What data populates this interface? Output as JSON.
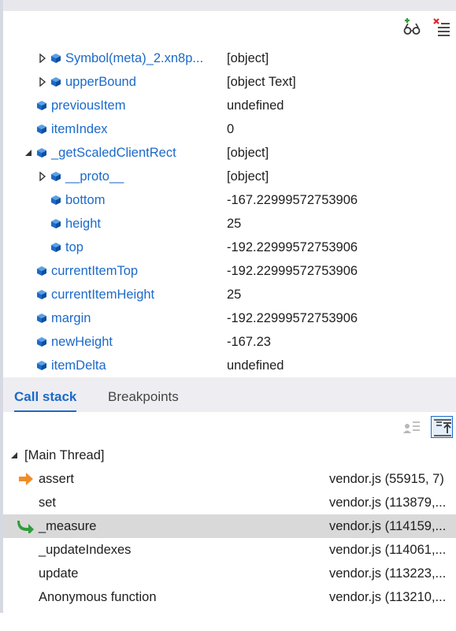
{
  "watch": {
    "rows": [
      {
        "name": "Symbol(meta)_2.xn8p...",
        "value": "[object]",
        "expander": "collapsed",
        "indent": 1
      },
      {
        "name": "upperBound",
        "value": "[object Text]",
        "expander": "collapsed",
        "indent": 1
      },
      {
        "name": "previousItem",
        "value": "undefined",
        "expander": "none",
        "indent": 0
      },
      {
        "name": "itemIndex",
        "value": "0",
        "expander": "none",
        "indent": 0
      },
      {
        "name": "_getScaledClientRect",
        "value": "[object]",
        "expander": "expanded",
        "indent": 0
      },
      {
        "name": "__proto__",
        "value": "[object]",
        "expander": "collapsed",
        "indent": 1
      },
      {
        "name": "bottom",
        "value": "-167.22999572753906",
        "expander": "none",
        "indent": 1
      },
      {
        "name": "height",
        "value": "25",
        "expander": "none",
        "indent": 1
      },
      {
        "name": "top",
        "value": "-192.22999572753906",
        "expander": "none",
        "indent": 1
      },
      {
        "name": "currentItemTop",
        "value": "-192.22999572753906",
        "expander": "none",
        "indent": 0
      },
      {
        "name": "currentItemHeight",
        "value": "25",
        "expander": "none",
        "indent": 0
      },
      {
        "name": "margin",
        "value": "-192.22999572753906",
        "expander": "none",
        "indent": 0
      },
      {
        "name": "newHeight",
        "value": "-167.23",
        "expander": "none",
        "indent": 0
      },
      {
        "name": "itemDelta",
        "value": "undefined",
        "expander": "none",
        "indent": 0
      }
    ]
  },
  "tabs": [
    {
      "label": "Call stack",
      "active": true
    },
    {
      "label": "Breakpoints",
      "active": false
    }
  ],
  "callstack": {
    "thread_label": "[Main Thread]",
    "frames": [
      {
        "name": "assert",
        "location": "vendor.js (55915, 7)",
        "marker": "current-frame-arrow"
      },
      {
        "name": "set",
        "location": "vendor.js (113879,...",
        "marker": "none"
      },
      {
        "name": "_measure",
        "location": "vendor.js (114159,...",
        "marker": "call-return-arrow",
        "selected": true
      },
      {
        "name": "_updateIndexes",
        "location": "vendor.js (114061,...",
        "marker": "none"
      },
      {
        "name": "update",
        "location": "vendor.js (113223,...",
        "marker": "none"
      },
      {
        "name": "Anonymous function",
        "location": "vendor.js (113210,...",
        "marker": "none"
      }
    ]
  },
  "icons": {
    "add_watch": "add-watch-icon",
    "delete_all": "delete-all-watches-icon",
    "property": "property-cube-icon",
    "show_external": "show-external-code-icon",
    "step_into": "step-into-frame-icon"
  },
  "colors": {
    "accent": "#1b6ac9",
    "selection": "#d9d9d9",
    "current_frame": "#f28c28",
    "return_frame": "#2e9d3a"
  }
}
